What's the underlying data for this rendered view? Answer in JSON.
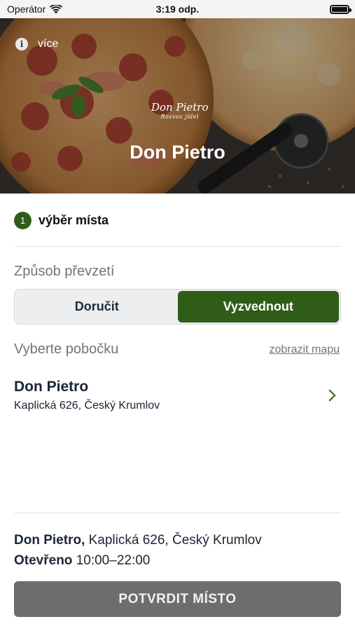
{
  "status_bar": {
    "carrier": "Operátor",
    "time": "3:19 odp.",
    "icons": [
      "wifi-icon",
      "battery-icon"
    ]
  },
  "hero": {
    "info_label": "více",
    "logo_text": "Don Pietro",
    "logo_subtext": "Rozvoz jídel",
    "title": "Don Pietro"
  },
  "step": {
    "number": "1",
    "label": "výběr místa"
  },
  "pickup": {
    "section_label": "Způsob převzetí",
    "options": [
      "Doručit",
      "Vyzvednout"
    ],
    "selected": "Vyzvednout"
  },
  "branch_select": {
    "section_label": "Vyberte pobočku",
    "map_link": "zobrazit mapu",
    "branches": [
      {
        "name": "Don Pietro",
        "address": "Kaplická 626, Český Krumlov"
      }
    ]
  },
  "summary": {
    "name": "Don Pietro,",
    "address": "Kaplická 626, Český Krumlov",
    "open_label": "Otevřeno",
    "hours": "10:00–22:00"
  },
  "confirm_button": "POTVRDIT MÍSTO",
  "colors": {
    "accent": "#2f5d17",
    "button_disabled": "#6d6d6b",
    "muted_text": "#6f757c"
  }
}
